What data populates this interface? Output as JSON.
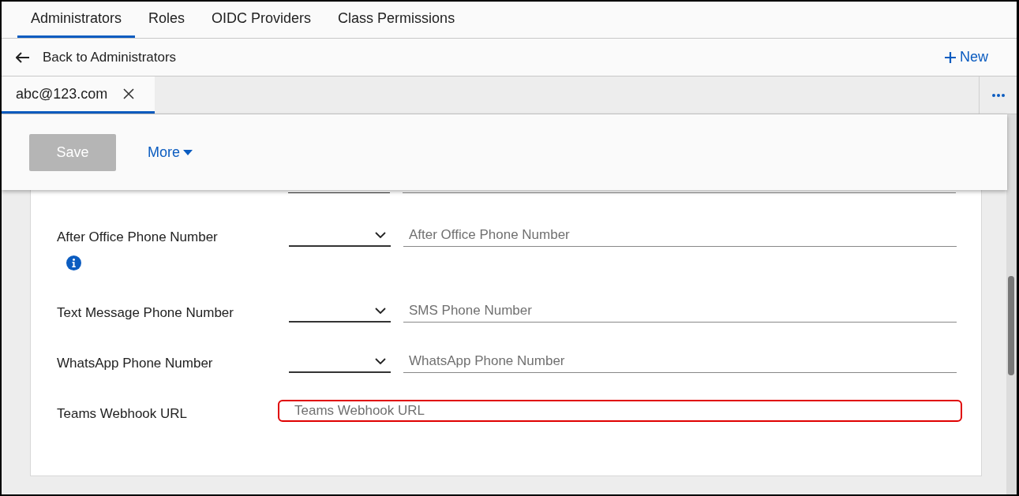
{
  "tabs": [
    {
      "label": "Administrators",
      "selected": true
    },
    {
      "label": "Roles",
      "selected": false
    },
    {
      "label": "OIDC Providers",
      "selected": false
    },
    {
      "label": "Class Permissions",
      "selected": false
    }
  ],
  "back_link": {
    "label": "Back to Administrators"
  },
  "new_button": {
    "label": "New"
  },
  "record_tabs": [
    {
      "label": "abc@123.com",
      "selected": true
    }
  ],
  "toolbar": {
    "save_button": {
      "label": "Save",
      "disabled": true
    },
    "more_menu": {
      "label": "More"
    }
  },
  "fields": [
    {
      "kind": "phone",
      "label": "After Office Phone Number",
      "has_info": true,
      "placeholder": "After Office Phone Number",
      "invalid": false
    },
    {
      "kind": "phone",
      "label": "Text Message Phone Number",
      "has_info": false,
      "placeholder": "SMS Phone Number",
      "invalid": false
    },
    {
      "kind": "phone",
      "label": "WhatsApp Phone Number",
      "has_info": false,
      "placeholder": "WhatsApp Phone Number",
      "invalid": false
    },
    {
      "kind": "url",
      "label": "Teams Webhook URL",
      "has_info": false,
      "placeholder": "Teams Webhook URL",
      "invalid": true
    }
  ]
}
